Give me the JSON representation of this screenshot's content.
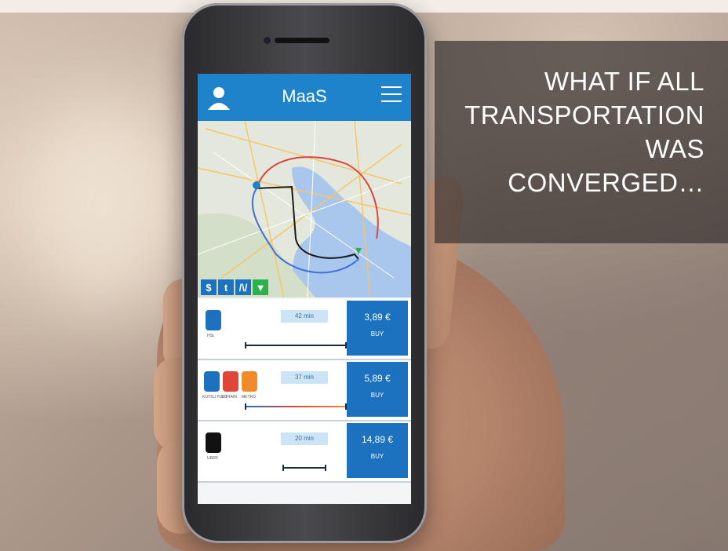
{
  "caption": {
    "lines": [
      "WHAT IF ALL",
      "TRANSPORTATION",
      "WAS",
      "CONVERGED…"
    ]
  },
  "app": {
    "title": "MaaS",
    "map_tools": [
      "$",
      "t",
      "/\\/",
      "▼"
    ],
    "options": [
      {
        "duration": "42 min",
        "price": "3,89 €",
        "buy_label": "BUY",
        "modes": [
          {
            "label": "HSL",
            "icon": "bus-icon",
            "color": "#1c72bf"
          }
        ]
      },
      {
        "duration": "37 min",
        "price": "5,89 €",
        "buy_label": "BUY",
        "modes": [
          {
            "label": "KUTSU PLUS",
            "icon": "bus-icon",
            "color": "#1c72bf"
          },
          {
            "label": "E-TRAIN",
            "icon": "train-icon",
            "color": "#e0463b"
          },
          {
            "label": "METRO",
            "icon": "metro-icon",
            "color": "#f08a2b"
          }
        ]
      },
      {
        "duration": "20 min",
        "price": "14,89 €",
        "buy_label": "BUY",
        "modes": [
          {
            "label": "UBER",
            "icon": "car-icon",
            "color": "#111111"
          }
        ]
      }
    ]
  },
  "colors": {
    "header": "#1f83cc",
    "price_box": "#1c72bf",
    "route_red": "#d9463c",
    "route_black": "#1a1a1a",
    "route_blue": "#3f6fd8"
  }
}
